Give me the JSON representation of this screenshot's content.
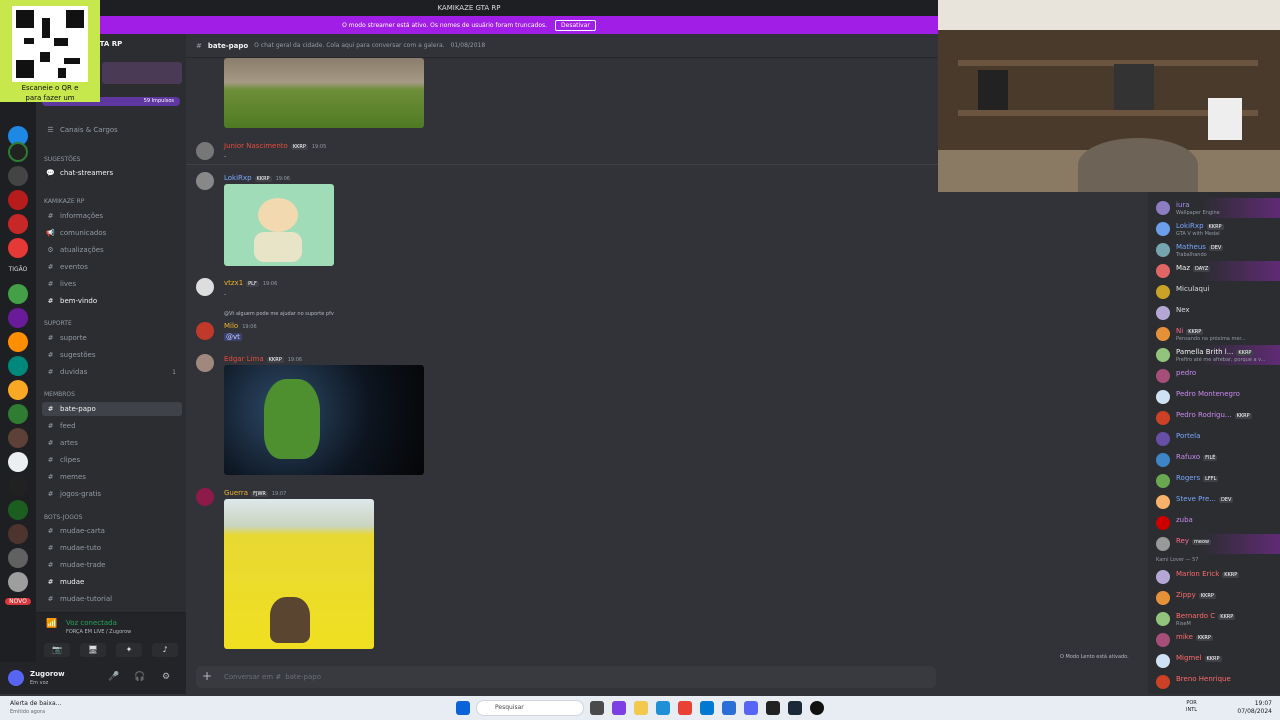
{
  "window": {
    "title": "KAMIKAZE GTA RP"
  },
  "banner": {
    "text": "O modo streamer está ativo. Os nomes de usuário foram truncados.",
    "button": "Desativar"
  },
  "qr": {
    "caption_line1": "Escaneie o QR e",
    "caption_line2": "para fazer um"
  },
  "guilds": {
    "label_tigao": "TIGÃO",
    "label_novo": "NOVO"
  },
  "server": {
    "name": "GTA RP",
    "boosts": "59 Impulsos"
  },
  "sidebar": {
    "channels_roles": "Canais & Cargos",
    "cat_suggestions": "Sugestões",
    "chat_streamers": "chat-streamers",
    "cat_kamikaze": "KAMIKAZE RP",
    "informacoes": "informações",
    "comunicados": "comunicados",
    "atualizacoes": "atualizações",
    "eventos": "eventos",
    "lives": "lives",
    "bem_vindo": "bem-vindo",
    "cat_suporte": "SUPORTE",
    "suporte": "suporte",
    "sugestoes": "sugestões",
    "duvidas": "duvidas",
    "duvidas_count": "1",
    "cat_membros": "MEMBROS",
    "bate_papo": "bate-papo",
    "feed": "feed",
    "artes": "artes",
    "clipes": "clipes",
    "memes": "memes",
    "jogos_gratis": "jogos-gratis",
    "cat_bots": "bots-jogos",
    "mudae_carta": "mudae-carta",
    "mudae_tuto": "mudae-tuto",
    "mudae_trade": "mudae-trade",
    "mudae": "mudae",
    "mudae_tutorial": "mudae-tutorial"
  },
  "voice": {
    "title": "Voz conectada",
    "sub": "FORÇA EM LIVE / Zugorow"
  },
  "user": {
    "name": "Zugorow",
    "status": "Em voz"
  },
  "chat": {
    "channel": "bate-papo",
    "topic": "O chat geral da cidade. Cola aqui para conversar com a galera.",
    "topic_date": "01/08/2018",
    "input_placeholder": "Conversar em #",
    "input_channel": "bate-papo",
    "slow_mode": "O Modo Lento está ativado."
  },
  "messages": [
    {
      "author": "Junior Nascimento",
      "tag": "KKRP",
      "time": "19:05",
      "text": "."
    },
    {
      "author": "LokiRxp",
      "tag": "KKRP",
      "time": "19:06",
      "text": ""
    },
    {
      "author": "vtzx1",
      "tag": "PLF",
      "time": "19:06",
      "text": "."
    },
    {
      "author": "Milo",
      "tag": "",
      "time": "19:06",
      "reply": "@Vt alguem pode me ajudar no suporte pfv",
      "text": "@vt"
    },
    {
      "author": "Edgar Lima",
      "tag": "KKRP",
      "time": "19:06",
      "text": ""
    },
    {
      "author": "Guerra",
      "tag": "FJWR",
      "time": "19:07",
      "text": ""
    }
  ],
  "members": [
    {
      "name": "iura",
      "status": "Wallpaper Engine",
      "color": "#a98cf0"
    },
    {
      "name": "LokiRxp",
      "status": "GTA V with Medal",
      "color": "#7aa7ff",
      "tag": "KKRP"
    },
    {
      "name": "Matheus",
      "status": "Trabalhando",
      "color": "#7aa7ff",
      "tag": "DEV"
    },
    {
      "name": "Maz",
      "status": "",
      "color": "#f2f3f5",
      "tag": "DAYZ"
    },
    {
      "name": "Miculaqui",
      "status": "",
      "color": "#dbdee1"
    },
    {
      "name": "Nex",
      "status": "",
      "color": "#dbdee1"
    },
    {
      "name": "Ni",
      "status": "Pensando na próxima mer...",
      "color": "#ff6b8a",
      "tag": "KKRP"
    },
    {
      "name": "Pamella Brith l...",
      "status": "Prefiro até me afrebar, porque a v...",
      "color": "#f2f3f5",
      "tag": "KKRP"
    },
    {
      "name": "pedro",
      "status": "",
      "color": "#c98af0"
    },
    {
      "name": "Pedro Montenegro",
      "status": "",
      "color": "#c98af0"
    },
    {
      "name": "Pedro Rodrigu...",
      "status": "",
      "color": "#c98af0",
      "tag": "KKRP"
    },
    {
      "name": "Portela",
      "status": "",
      "color": "#7aa7ff"
    },
    {
      "name": "Rafuxo",
      "status": "",
      "color": "#c98af0",
      "tag": "FILÉ"
    },
    {
      "name": "Rogers",
      "status": "",
      "color": "#7aa7ff",
      "tag": "LFFL"
    },
    {
      "name": "Steve Pre...",
      "status": "",
      "color": "#7aa7ff",
      "tag": "DEV"
    },
    {
      "name": "zuba",
      "status": "",
      "color": "#c98af0"
    },
    {
      "name": "Rey",
      "status": "",
      "color": "#ff6b8a",
      "tag": "meow"
    }
  ],
  "members_category": "Kami Lover — 57",
  "members2": [
    {
      "name": "Marlon Erick",
      "color": "#ff6b6b",
      "tag": "KKRP"
    },
    {
      "name": "Zippy",
      "color": "#ff6b6b",
      "tag": "KKRP"
    },
    {
      "name": "Bernardo C",
      "status": "RiseM",
      "color": "#ff6b6b",
      "tag": "KKRP"
    },
    {
      "name": "mike",
      "color": "#ff6b6b",
      "tag": "KKRP"
    },
    {
      "name": "Migmel",
      "color": "#ff6b6b",
      "tag": "KKRP"
    },
    {
      "name": "Breno Henrique",
      "color": "#ff6b6b"
    }
  ],
  "taskbar": {
    "search": "Pesquisar",
    "notif_title": "Alerta de baixa...",
    "notif_sub": "Emitido agora",
    "lang": "POR",
    "lang2": "INTL",
    "time": "19:07",
    "date": "07/08/2024"
  }
}
